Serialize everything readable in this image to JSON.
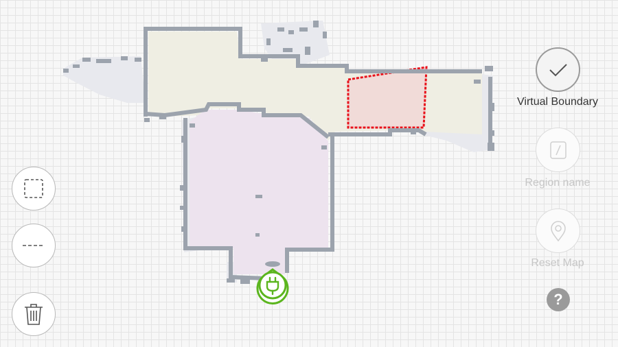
{
  "colors": {
    "wall": "#9ca3ad",
    "floor_room_1": "#efeee3",
    "floor_room_2": "#ede3ee",
    "explored_halo": "#e8e9ee",
    "boundary_line": "#e8121b",
    "boundary_fill": "#f1d7d6",
    "dock_green": "#5bb51e"
  },
  "left_toolbar": {
    "buttons": [
      {
        "name": "rectangle-zone-button",
        "icon": "dashed-square-icon"
      },
      {
        "name": "line-boundary-button",
        "icon": "dashed-line-icon"
      },
      {
        "name": "delete-button",
        "icon": "trash-icon"
      }
    ]
  },
  "right_toolbar": {
    "virtual_boundary": {
      "label": "Virtual Boundary",
      "icon": "checkmark-icon",
      "state": "active"
    },
    "region_name": {
      "label": "Region name",
      "icon": "edit-icon",
      "state": "disabled"
    },
    "reset_map": {
      "label": "Reset Map",
      "icon": "location-pin-icon",
      "state": "disabled"
    },
    "help": {
      "glyph": "?",
      "icon": "help-icon"
    }
  },
  "map": {
    "dock_icon": "charging-plug-icon"
  }
}
